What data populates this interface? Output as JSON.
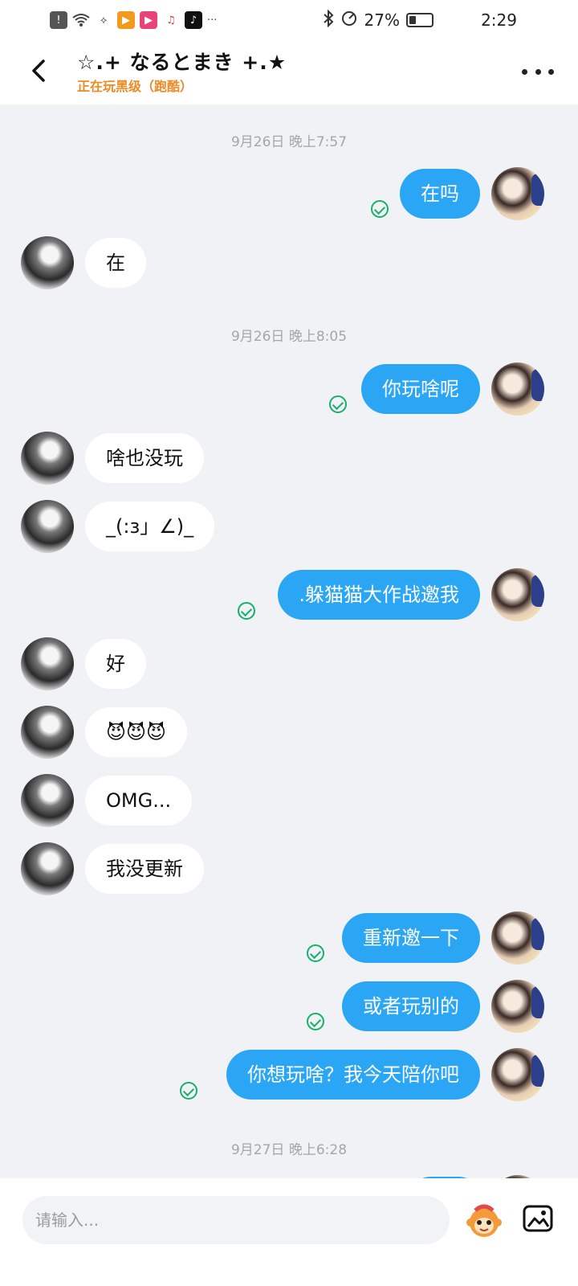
{
  "status_bar": {
    "battery": "27%",
    "time": "2:29",
    "more_dots": "···"
  },
  "header": {
    "title": "☆.+ なるとまき +.★",
    "subtitle": "正在玩黑级（跑酷）"
  },
  "messages": [
    {
      "type": "timestamp",
      "text": "9月26日 晚上7:57"
    },
    {
      "type": "out",
      "text": "在吗"
    },
    {
      "type": "in",
      "text": "在"
    },
    {
      "type": "timestamp",
      "text": "9月26日 晚上8:05"
    },
    {
      "type": "out",
      "text": "你玩啥呢"
    },
    {
      "type": "in",
      "text": "啥也没玩"
    },
    {
      "type": "in",
      "text": "_(:з」∠)_"
    },
    {
      "type": "out",
      "text": ".躲猫猫大作战邀我"
    },
    {
      "type": "in",
      "text": "好"
    },
    {
      "type": "in",
      "text": "😈😈😈"
    },
    {
      "type": "in",
      "text": "OMG..."
    },
    {
      "type": "in",
      "text": "我没更新"
    },
    {
      "type": "out",
      "text": "重新邀一下"
    },
    {
      "type": "out",
      "text": "或者玩别的"
    },
    {
      "type": "out",
      "text": "你想玩啥？我今天陪你吧"
    },
    {
      "type": "timestamp",
      "text": "9月27日 晚上6:28"
    }
  ],
  "input": {
    "placeholder": "请输入..."
  },
  "colors": {
    "outgoing_bubble": "#2aa6f5",
    "incoming_bubble": "#ffffff",
    "chat_background": "#f1f2f6",
    "status_subtitle": "#f08a23",
    "read_check": "#18b06a"
  },
  "icons": {
    "back": "chevron-left-icon",
    "more": "more-icon",
    "emoji": "monkey-emoji-icon",
    "image": "image-icon"
  }
}
